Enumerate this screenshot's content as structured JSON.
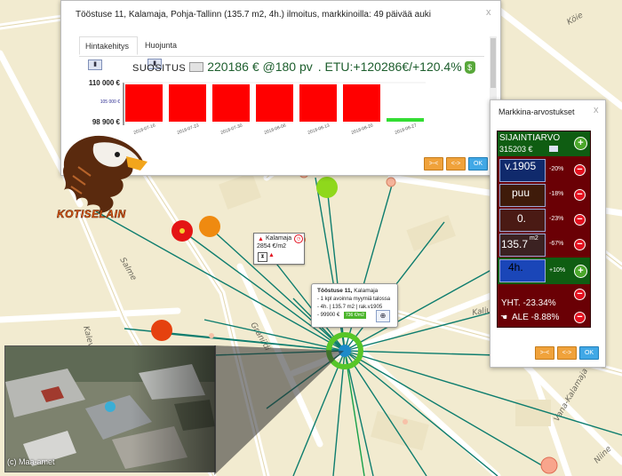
{
  "map": {
    "streets": [
      "Köie",
      "Salme",
      "Kalevi",
      "Graniidi",
      "Kalju",
      "Vana-Kalamaja",
      "Niine"
    ],
    "copyright": "(c) Maa-amet"
  },
  "main_panel": {
    "title": "Tööstuse 11, Kalamaja, Pohja-Tallinn (135.7 m2, 4h.) ilmoitus, markkinoilla: 49 päivää auki",
    "tabs": [
      {
        "label": "Hintakehitys"
      },
      {
        "label": "Huojunta"
      }
    ],
    "recommend_label": "SUOSITUS",
    "recommend_price": "220186 € @180 pv",
    "recommend_gain": ". ETU:+120286€/+120.4%",
    "buttons": [
      {
        "label": ">-<"
      },
      {
        "label": "<->"
      },
      {
        "label": "OK"
      }
    ]
  },
  "chart_data": {
    "type": "bar",
    "categories": [
      "2018-07-16",
      "2018-07-23",
      "2018-07-30",
      "2018-08-06",
      "2018-08-13",
      "2018-08-20",
      "2018-08-27"
    ],
    "values": [
      110000,
      110000,
      110000,
      110000,
      110000,
      110000,
      99900
    ],
    "ylim": [
      98900,
      110000
    ],
    "ytick_labels": [
      "110 000 €",
      "105 000 €",
      "98 900 €"
    ],
    "colors": [
      "#ff0000",
      "#ff0000",
      "#ff0000",
      "#ff0000",
      "#ff0000",
      "#ff0000",
      "#33dd33"
    ]
  },
  "logo": {
    "text": "KOTISELAIN"
  },
  "right_panel": {
    "title": "Markkina-arvostukset",
    "location": {
      "label": "SIJAINTIARVO",
      "value": "315203 €"
    },
    "factors": [
      {
        "label": "v.1905",
        "pct": "-20%"
      },
      {
        "label": "puu",
        "pct": "-18%"
      },
      {
        "label": "0.",
        "pct": "-23%"
      },
      {
        "label": "135.7",
        "unit": "m2",
        "pct": "-67%"
      },
      {
        "label": "4h.",
        "pct": "+10%"
      }
    ],
    "total": "YHT. -23.34%",
    "discount": "ALE -8.88%",
    "buttons": [
      {
        "label": ">-<"
      },
      {
        "label": "<->"
      },
      {
        "label": "OK"
      }
    ]
  },
  "kalamaja_tip": {
    "name": "Kalamaja",
    "price": "2854 €/m2"
  },
  "house_tip": {
    "title": "Tööstuse 11,",
    "district": "Kalamaja",
    "line1": "- 1 kpl avoinna myymiä talossa",
    "line2": "- 4h. | 135.7 m2 | rak.v1905",
    "price": "- 99900 €",
    "badge": "736 €/m2"
  }
}
